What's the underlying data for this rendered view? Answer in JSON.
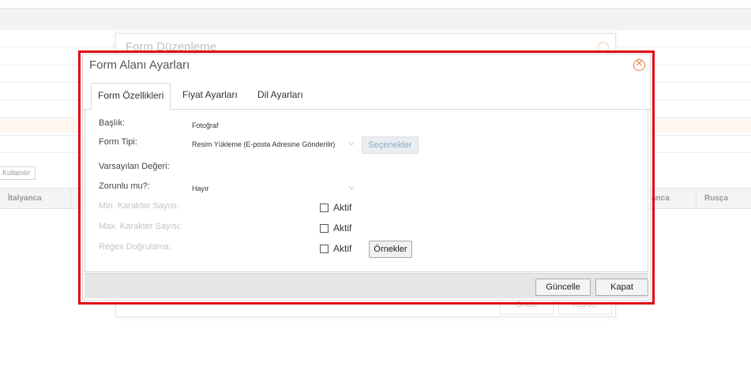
{
  "background": {
    "kullan_badge": "Kullanılır",
    "columns": [
      "İtalyanca",
      "anca",
      "Rusça"
    ],
    "underlying_dialog": {
      "title": "Form Düzenleme",
      "buttons": [
        "Önizle",
        "Kaydet"
      ]
    }
  },
  "dialog": {
    "title": "Form Alanı Ayarları",
    "close_icon": "close-circle-icon",
    "tabs": [
      {
        "label": "Form Özellikleri",
        "active": true
      },
      {
        "label": "Fiyat Ayarları",
        "active": false
      },
      {
        "label": "Dil Ayarları",
        "active": false
      }
    ],
    "fields": {
      "baslik": {
        "label": "Başlık:",
        "value": "Fotoğraf"
      },
      "form_tipi": {
        "label": "Form Tipi:",
        "value": "Resim Yükleme (E-posta Adresine Gönderilir)"
      },
      "secenekler_button": "Seçenekler",
      "varsayilan": {
        "label": "Varsayılan Değeri:"
      },
      "zorunlu": {
        "label": "Zorunlu mu?:",
        "value": "Hayır"
      },
      "min_karakter": {
        "label": "Min. Karakter Sayısı:",
        "checkbox_label": "Aktif"
      },
      "max_karakter": {
        "label": "Max. Karakter Sayısı:",
        "checkbox_label": "Aktif"
      },
      "regex": {
        "label": "Regex Doğrulama:",
        "checkbox_label": "Aktif"
      },
      "ornekler_button": "Örnekler"
    },
    "footer": {
      "update_button": "Güncelle",
      "close_button": "Kapat"
    }
  },
  "colors": {
    "highlight": "#e10613",
    "close_accent": "#e8793b",
    "disabled_button_text": "#8aa9c1"
  }
}
